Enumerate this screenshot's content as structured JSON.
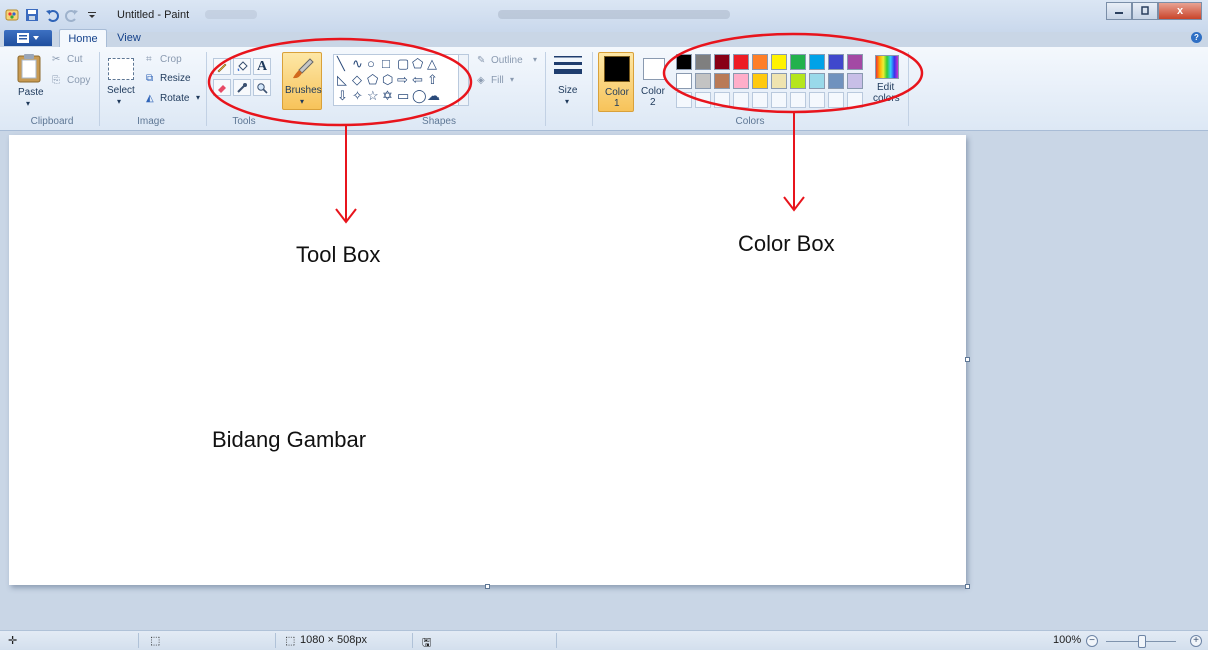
{
  "window": {
    "title": "Untitled - Paint",
    "close_label": "x"
  },
  "tabs": [
    {
      "label": "Home",
      "active": true
    },
    {
      "label": "View",
      "active": false
    }
  ],
  "ribbon": {
    "clipboard": {
      "paste": "Paste",
      "cut": "Cut",
      "copy": "Copy",
      "group": "Clipboard"
    },
    "image": {
      "select": "Select",
      "crop": "Crop",
      "resize": "Resize",
      "rotate": "Rotate",
      "group": "Image"
    },
    "tools": {
      "group": "Tools",
      "text_tool": "A"
    },
    "brushes": {
      "label": "Brushes"
    },
    "shapes": {
      "outline": "Outline",
      "fill": "Fill",
      "group": "Shapes"
    },
    "size": {
      "label": "Size"
    },
    "colors": {
      "color1": "Color",
      "color1_num": "1",
      "color2": "Color",
      "color2_num": "2",
      "edit_line1": "Edit",
      "edit_line2": "colors",
      "group": "Colors",
      "palette_row1": [
        "#000000",
        "#7f7f7f",
        "#880015",
        "#ed1c24",
        "#ff7f27",
        "#fff200",
        "#22b14c",
        "#00a2e8",
        "#3f48cc",
        "#a349a4"
      ],
      "palette_row2": [
        "#ffffff",
        "#c3c3c3",
        "#b97a57",
        "#ffaec9",
        "#ffc90e",
        "#efe4b0",
        "#b5e61d",
        "#99d9ea",
        "#7092be",
        "#c8bfe7"
      ]
    }
  },
  "annotations": {
    "tool_box": "Tool Box",
    "color_box": "Color Box",
    "canvas_label": "Bidang Gambar",
    "highlight_color": "#e8141c"
  },
  "status": {
    "canvas_size": "1080 × 508px",
    "zoom": "100%",
    "zoom_out": "−",
    "zoom_in": "+"
  }
}
